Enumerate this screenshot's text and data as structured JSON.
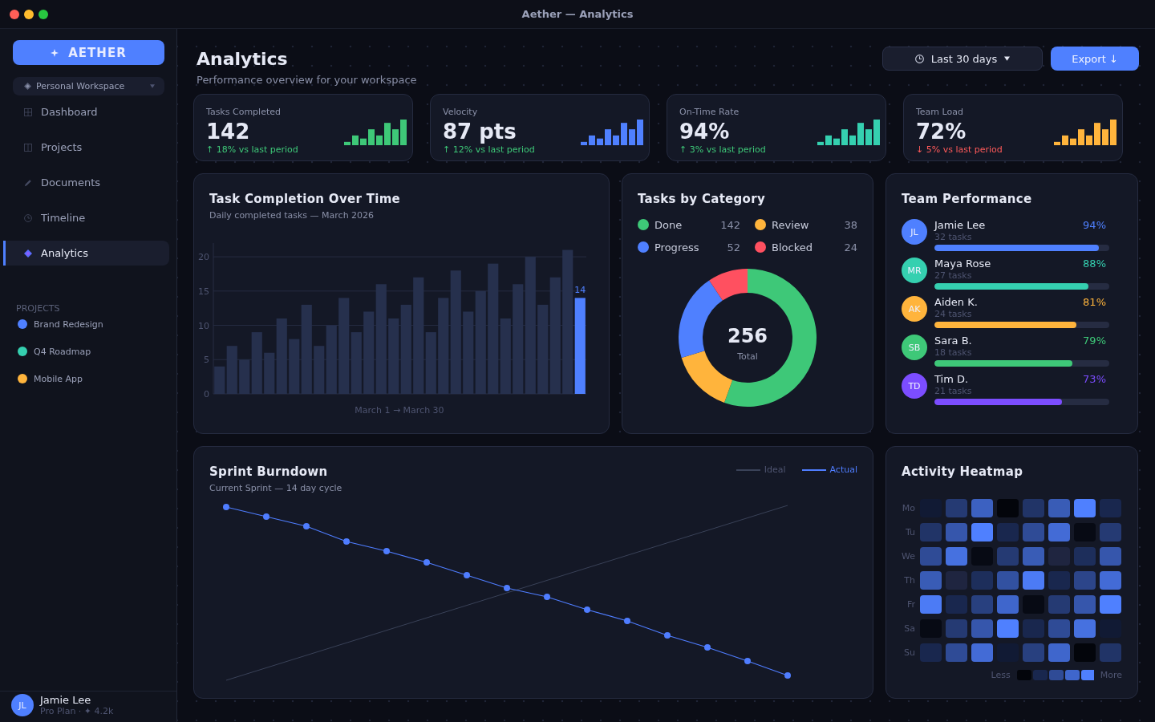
{
  "window": {
    "title": "Aether — Analytics"
  },
  "sidebar": {
    "brand": "AETHER",
    "workspace": "Personal Workspace",
    "nav": [
      {
        "label": "Dashboard",
        "selected": false
      },
      {
        "label": "Projects",
        "selected": false
      },
      {
        "label": "Documents",
        "selected": false
      },
      {
        "label": "Timeline",
        "selected": false
      },
      {
        "label": "Analytics",
        "selected": true
      }
    ],
    "projects_heading": "PROJECTS",
    "projects": [
      {
        "label": "Brand Redesign",
        "color": "#4f80ff"
      },
      {
        "label": "Q4 Roadmap",
        "color": "#35d0b0"
      },
      {
        "label": "Mobile App",
        "color": "#ffb43c"
      }
    ],
    "user": {
      "initials": "JL",
      "name": "Jamie Lee",
      "plan": "Pro Plan · ✦ 4.2k"
    }
  },
  "header": {
    "title": "Analytics",
    "subtitle": "Performance overview for your workspace",
    "date_range": "Last 30 days",
    "export": "Export ↓"
  },
  "kpis": [
    {
      "label": "Tasks Completed",
      "value": "142",
      "delta": "↑ 18% vs last period",
      "positive": true,
      "color": "#3ec878"
    },
    {
      "label": "Velocity",
      "value": "87 pts",
      "delta": "↑ 12% vs last period",
      "positive": true,
      "color": "#4f80ff"
    },
    {
      "label": "On-Time Rate",
      "value": "94%",
      "delta": "↑ 3% vs last period",
      "positive": true,
      "color": "#35d0b0"
    },
    {
      "label": "Team Load",
      "value": "72%",
      "delta": "↓ 5% vs last period",
      "positive": false,
      "color": "#ffb43c"
    }
  ],
  "task_completion": {
    "title": "Task Completion Over Time",
    "subtitle": "Daily completed tasks — March 2026",
    "chart_data": {
      "type": "bar",
      "xlabel": "March 1 → March 30",
      "series": [
        {
          "color": "#26304d",
          "values": [
            4,
            7,
            5,
            9,
            6,
            11,
            8,
            13,
            7,
            10,
            14,
            9,
            12,
            16,
            11,
            13,
            17,
            9,
            14,
            18,
            12,
            15,
            19,
            11,
            16,
            20,
            13,
            17,
            21,
            0
          ]
        },
        {
          "color": "#4f80ff",
          "values": [
            0,
            0,
            0,
            0,
            0,
            0,
            0,
            0,
            0,
            0,
            0,
            0,
            0,
            0,
            0,
            0,
            0,
            0,
            0,
            0,
            0,
            0,
            0,
            0,
            0,
            0,
            0,
            0,
            0,
            14
          ]
        }
      ],
      "stacked": true,
      "ylim": [
        0,
        22
      ],
      "yticks": [
        0,
        5,
        10,
        15,
        20
      ],
      "grid": true,
      "annotations": [
        "14"
      ]
    }
  },
  "tasks_by_category": {
    "title": "Tasks by Category",
    "chart_data": {
      "type": "donut",
      "categories": [
        "Done",
        "Review",
        "Progress",
        "Blocked"
      ],
      "values": [
        55.47,
        14.84,
        20.31,
        9.38
      ]
    },
    "legend": [
      {
        "value": "142",
        "color": "#3ec878"
      },
      {
        "value": "38",
        "color": "#ffb43c"
      },
      {
        "value": "52",
        "color": "#4f80ff"
      },
      {
        "value": "24",
        "color": "#ff5060"
      }
    ],
    "total": "256",
    "total_label": "Total"
  },
  "team_performance": {
    "title": "Team Performance",
    "members": [
      {
        "initials": "JL",
        "name": "Jamie Lee",
        "tasks": "32 tasks",
        "percent": "94%",
        "level": 0.94,
        "color": "#4f80ff"
      },
      {
        "initials": "MR",
        "name": "Maya Rose",
        "tasks": "27 tasks",
        "percent": "88%",
        "level": 0.88,
        "color": "#35d0b0"
      },
      {
        "initials": "AK",
        "name": "Aiden K.",
        "tasks": "24 tasks",
        "percent": "81%",
        "level": 0.81,
        "color": "#ffb43c"
      },
      {
        "initials": "SB",
        "name": "Sara B.",
        "tasks": "18 tasks",
        "percent": "79%",
        "level": 0.79,
        "color": "#3ec878"
      },
      {
        "initials": "TD",
        "name": "Tim D.",
        "tasks": "21 tasks",
        "percent": "73%",
        "level": 0.73,
        "color": "#7c4dff"
      }
    ]
  },
  "sprint_burndown": {
    "title": "Sprint Burndown",
    "subtitle": "Current Sprint — 14 day cycle",
    "legend": [
      {
        "label": "Ideal",
        "color": "#3a4258"
      },
      {
        "label": "Actual",
        "color": "#4f7dff"
      }
    ]
  },
  "activity_heatmap": {
    "title": "Activity Heatmap",
    "rows": [
      {
        "day": "Mo",
        "cells": [
          {
            "color": "#111a34"
          },
          {
            "color": "#253a73"
          },
          {
            "color": "#3c61c1"
          },
          {
            "color": "#03050b"
          },
          {
            "color": "#213467"
          },
          {
            "color": "#395cb6"
          },
          {
            "color": "#4f80ff"
          },
          {
            "color": "#19274e"
          }
        ]
      },
      {
        "day": "Tu",
        "cells": [
          {
            "color": "#213467"
          },
          {
            "color": "#3656ac"
          },
          {
            "color": "#4f80ff"
          },
          {
            "color": "#19274e"
          },
          {
            "color": "#2f4b96"
          },
          {
            "color": "#436bd6"
          },
          {
            "color": "#070a14"
          },
          {
            "color": "#253a73"
          }
        ]
      },
      {
        "day": "We",
        "cells": [
          {
            "color": "#2f4b96"
          },
          {
            "color": "#4671e0"
          },
          {
            "color": "#070a14"
          },
          {
            "color": "#253a73"
          },
          {
            "color": "#395cb6"
          },
          {
            "color": "#1f2540"
          },
          {
            "color": "#1d2e5b"
          },
          {
            "color": "#3656ac"
          }
        ]
      },
      {
        "day": "Th",
        "cells": [
          {
            "color": "#395cb6"
          },
          {
            "color": "#1f2540"
          },
          {
            "color": "#1d2e5b"
          },
          {
            "color": "#3251a1"
          },
          {
            "color": "#4c7bf5"
          },
          {
            "color": "#19274e"
          },
          {
            "color": "#2c458a"
          },
          {
            "color": "#436bd6"
          }
        ]
      },
      {
        "day": "Fr",
        "cells": [
          {
            "color": "#4c7bf5"
          },
          {
            "color": "#19274e"
          },
          {
            "color": "#28407f"
          },
          {
            "color": "#3f66cc"
          },
          {
            "color": "#070a14"
          },
          {
            "color": "#253a73"
          },
          {
            "color": "#3656ac"
          },
          {
            "color": "#4f80ff"
          }
        ]
      },
      {
        "day": "Sa",
        "cells": [
          {
            "color": "#070a14"
          },
          {
            "color": "#253a73"
          },
          {
            "color": "#3656ac"
          },
          {
            "color": "#4f80ff"
          },
          {
            "color": "#19274e"
          },
          {
            "color": "#2f4b96"
          },
          {
            "color": "#4671e0"
          },
          {
            "color": "#111a34"
          }
        ]
      },
      {
        "day": "Su",
        "cells": [
          {
            "color": "#19274e"
          },
          {
            "color": "#2f4b96"
          },
          {
            "color": "#436bd6"
          },
          {
            "color": "#111a34"
          },
          {
            "color": "#28407f"
          },
          {
            "color": "#3f66cc"
          },
          {
            "color": "#03050b"
          },
          {
            "color": "#213467"
          }
        ]
      }
    ],
    "less": "Less",
    "more": "More"
  }
}
